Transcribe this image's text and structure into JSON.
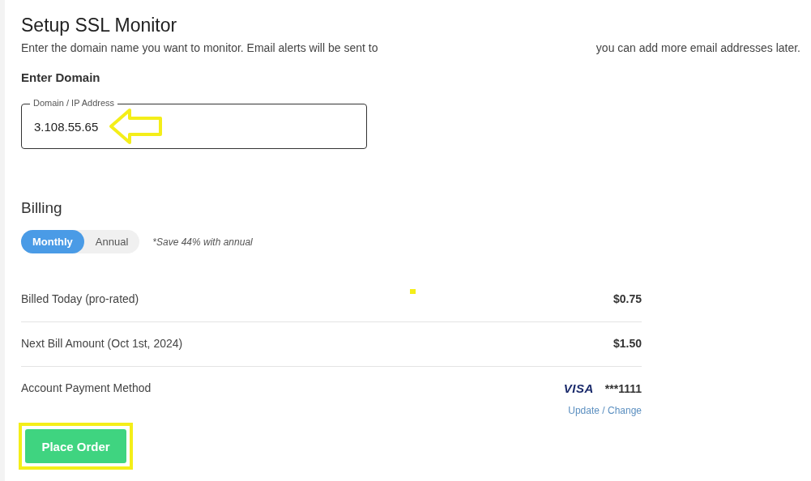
{
  "title": "Setup SSL Monitor",
  "intro": {
    "before": "Enter the domain name you want to monitor. Email alerts will be sent to",
    "after": "you can add more email addresses later."
  },
  "domain_section": {
    "heading": "Enter Domain",
    "field": {
      "label": "Domain / IP Address",
      "value": "3.108.55.65"
    }
  },
  "billing": {
    "heading": "Billing",
    "periods": [
      {
        "label": "Monthly",
        "selected": true
      },
      {
        "label": "Annual",
        "selected": false
      }
    ],
    "note": "*Save 44% with annual",
    "rows": [
      {
        "kind": "amount",
        "label": "Billed Today (pro-rated)",
        "value": "$0.75"
      },
      {
        "kind": "amount",
        "label": "Next Bill Amount (Oct 1st, 2024)",
        "value": "$1.50"
      },
      {
        "kind": "payment",
        "label": "Account Payment Method",
        "brand": "VISA",
        "value": "***1111",
        "link": "Update / Change"
      }
    ]
  },
  "place_order": "Place Order"
}
